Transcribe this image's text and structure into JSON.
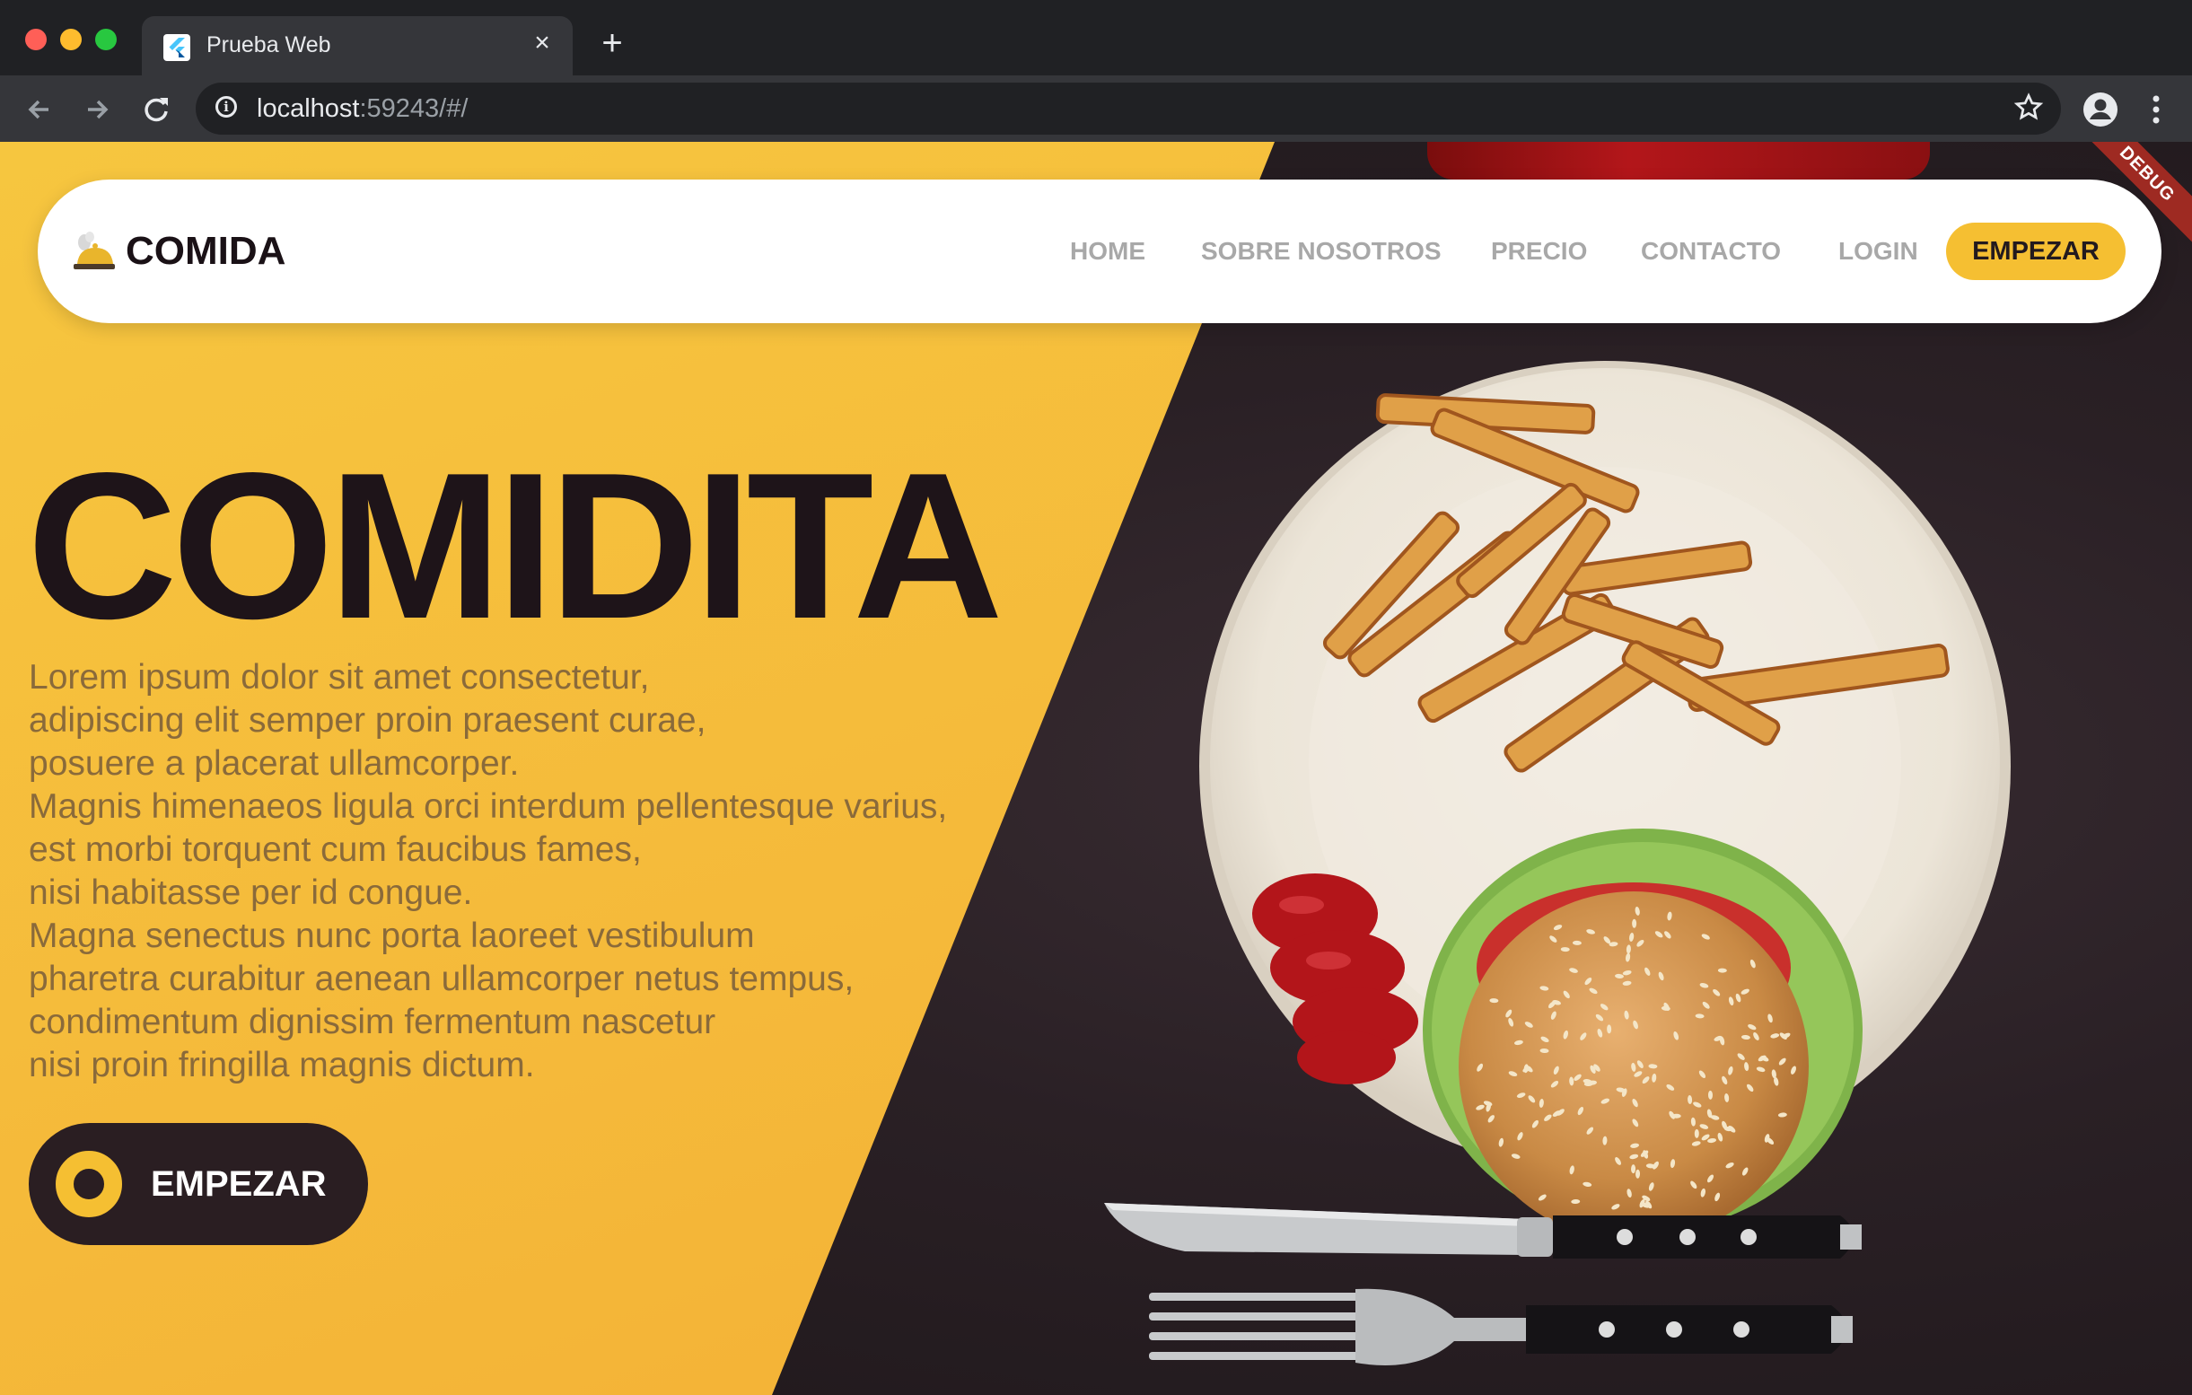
{
  "browser": {
    "tab_title": "Prueba Web",
    "tab_close": "×",
    "new_tab": "+",
    "url_host": "localhost",
    "url_rest": ":59243/#/"
  },
  "debug_banner": "DEBUG",
  "navbar": {
    "brand": "COMIDA",
    "links": [
      "HOME",
      "SOBRE NOSOTROS",
      "PRECIO",
      "CONTACTO",
      "LOGIN"
    ],
    "cta": "EMPEZAR"
  },
  "hero": {
    "title": "COMIDITA",
    "paragraph_lines": [
      "Lorem ipsum dolor sit amet consectetur,",
      "adipiscing elit semper proin praesent curae,",
      "posuere a placerat ullamcorper.",
      "Magnis himenaeos ligula orci interdum pellentesque varius,",
      "est morbi torquent cum faucibus fames,",
      "nisi habitasse per id congue.",
      "Magna senectus nunc porta laoreet vestibulum",
      "pharetra curabitur aenean ullamcorper netus tempus,",
      "condimentum dignissim fermentum nascetur",
      "nisi proin fringilla magnis dictum."
    ],
    "cta": "EMPEZAR"
  },
  "colors": {
    "accent_yellow": "#f5bf32",
    "dark": "#231a1e",
    "nav_link_gray": "#a8a8a8"
  }
}
